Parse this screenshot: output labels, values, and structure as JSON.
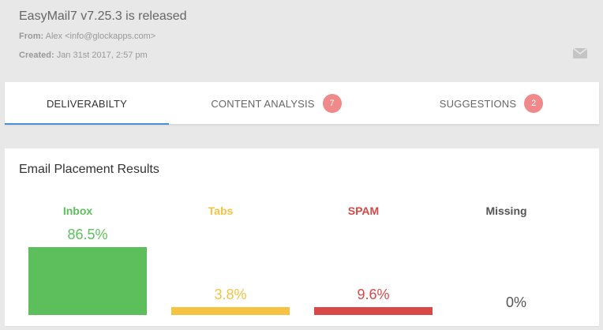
{
  "email": {
    "subject": "EasyMail7 v7.25.3 is released",
    "from_label": "From:",
    "from_value": "Alex <info@glockapps.com>",
    "created_label": "Created:",
    "created_value": "Jan 31st 2017, 2:57 pm"
  },
  "tabs": [
    {
      "label": "DELIVERABILTY",
      "active": true
    },
    {
      "label": "CONTENT ANALYSIS",
      "badge": "7"
    },
    {
      "label": "SUGGESTIONS",
      "badge": "2"
    }
  ],
  "placement": {
    "title": "Email Placement Results",
    "columns": [
      {
        "label": "Inbox",
        "value": "86.5%",
        "percent": 86.5,
        "color": "#5cbf5c"
      },
      {
        "label": "Tabs",
        "value": "3.8%",
        "percent": 3.8,
        "color": "#f5c242"
      },
      {
        "label": "SPAM",
        "value": "9.6%",
        "percent": 9.6,
        "color": "#d94848"
      },
      {
        "label": "Missing",
        "value": "0%",
        "percent": 0,
        "color": "#555555"
      }
    ]
  },
  "icons": {
    "mail": "envelope-icon"
  },
  "colors": {
    "accent": "#4a90d9",
    "badge": "#f0898a"
  }
}
